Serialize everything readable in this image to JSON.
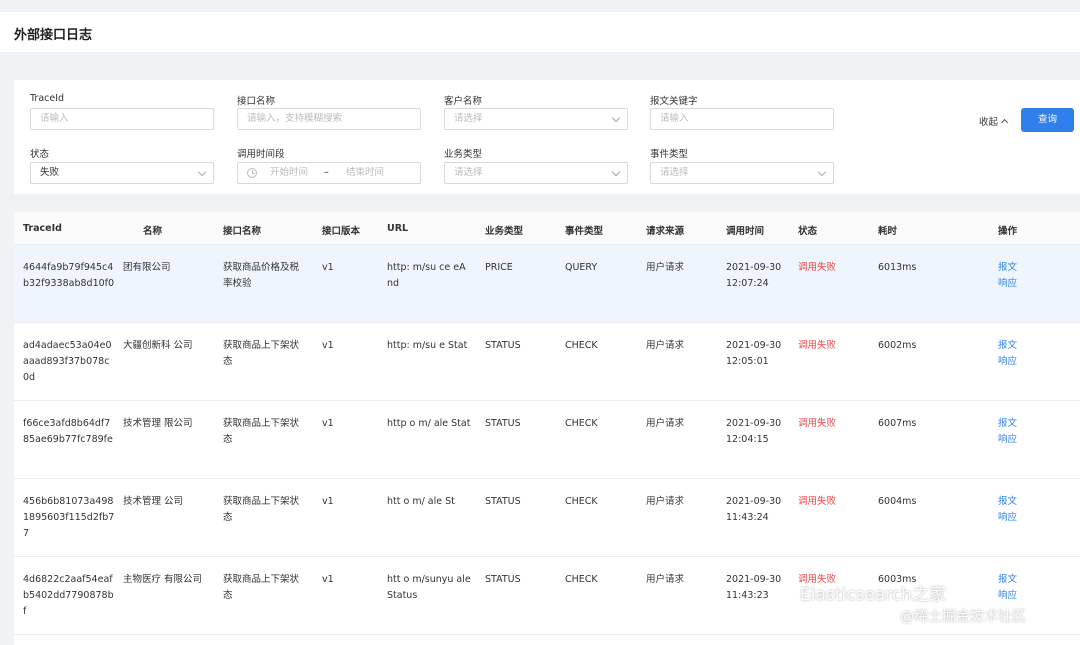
{
  "header": {
    "title": "外部接口日志"
  },
  "filters": {
    "traceid": {
      "label": "TraceId",
      "placeholder": "请输入"
    },
    "api_name": {
      "label": "接口名称",
      "placeholder": "请输入，支持模糊搜索"
    },
    "customer": {
      "label": "客户名称",
      "placeholder": "请选择"
    },
    "keyword": {
      "label": "报文关键字",
      "placeholder": "请输入"
    },
    "status": {
      "label": "状态",
      "value": "失败"
    },
    "time_range": {
      "label": "调用时间段",
      "start": "开始时间",
      "sep": "–",
      "end": "结束时间"
    },
    "biz_type": {
      "label": "业务类型",
      "placeholder": "请选择"
    },
    "event_type": {
      "label": "事件类型",
      "placeholder": "请选择"
    },
    "collapse_label": "收起",
    "query_label": "查询"
  },
  "table": {
    "columns": [
      "TraceId",
      "名称",
      "接口名称",
      "接口版本",
      "URL",
      "业务类型",
      "事件类型",
      "请求来源",
      "调用时间",
      "状态",
      "耗时",
      "操作"
    ],
    "rows": [
      {
        "traceid": "4644fa9b79f945c4b32f9338ab8d10f0",
        "customer": "团有限公司",
        "api": "获取商品价格及税率校验",
        "version": "v1",
        "url": "http: m/su ce eAnd",
        "biz": "PRICE",
        "event": "QUERY",
        "source": "用户请求",
        "time": "2021-09-30 12:07:24",
        "status": "调用失败",
        "cost": "6013ms",
        "op1": "报文",
        "op2": "响应"
      },
      {
        "traceid": "ad4adaec53a04e0aaad893f37b078c0d",
        "customer": "大疆创新科 公司",
        "api": "获取商品上下架状态",
        "version": "v1",
        "url": "http: m/su e Stat",
        "biz": "STATUS",
        "event": "CHECK",
        "source": "用户请求",
        "time": "2021-09-30 12:05:01",
        "status": "调用失败",
        "cost": "6002ms",
        "op1": "报文",
        "op2": "响应"
      },
      {
        "traceid": "f66ce3afd8b64df785ae69b77fc789fe",
        "customer": "技术管理 限公司",
        "api": "获取商品上下架状态",
        "version": "v1",
        "url": "http o m/ ale Stat",
        "biz": "STATUS",
        "event": "CHECK",
        "source": "用户请求",
        "time": "2021-09-30 12:04:15",
        "status": "调用失败",
        "cost": "6007ms",
        "op1": "报文",
        "op2": "响应"
      },
      {
        "traceid": "456b6b81073a4981895603f115d2fb77",
        "customer": "技术管理 公司",
        "api": "获取商品上下架状态",
        "version": "v1",
        "url": "htt o m/ ale St",
        "biz": "STATUS",
        "event": "CHECK",
        "source": "用户请求",
        "time": "2021-09-30 11:43:24",
        "status": "调用失败",
        "cost": "6004ms",
        "op1": "报文",
        "op2": "响应"
      },
      {
        "traceid": "4d6822c2aaf54eafb5402dd7790878bf",
        "customer": "主物医疗 有限公司",
        "api": "获取商品上下架状态",
        "version": "v1",
        "url": "htt o m/sunyu ale Status",
        "biz": "STATUS",
        "event": "CHECK",
        "source": "用户请求",
        "time": "2021-09-30 11:43:23",
        "status": "调用失败",
        "cost": "6003ms",
        "op1": "报文",
        "op2": "响应"
      }
    ]
  },
  "watermark": {
    "line1": "Elasticsearch之家",
    "line2": "@稀土掘金技术社区"
  }
}
